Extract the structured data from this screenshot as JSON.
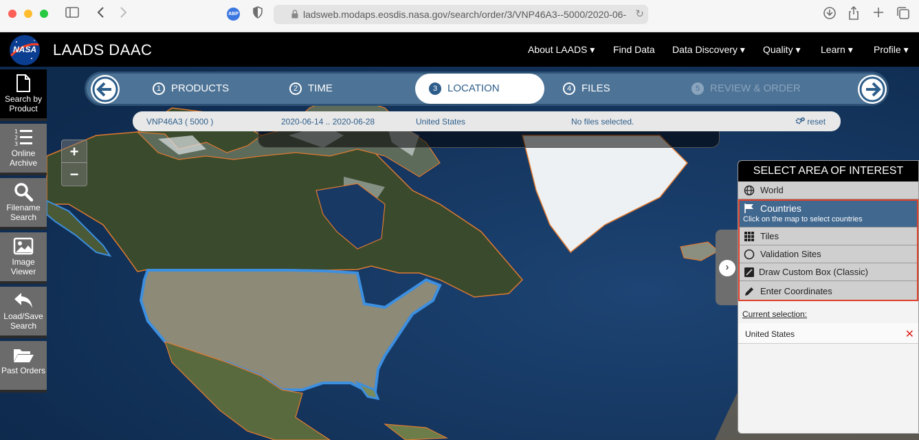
{
  "browser": {
    "url": "ladsweb.modaps.eosdis.nasa.gov/search/order/3/VNP46A3--5000/2020-06-",
    "extension_label": "ABP"
  },
  "site": {
    "logo_text": "NASA",
    "title": "LAADS DAAC",
    "nav": [
      "About LAADS ▾",
      "Find Data",
      "Data Discovery ▾",
      "Quality ▾",
      "Learn ▾",
      "Profile ▾"
    ]
  },
  "sidebar": [
    {
      "label_line1": "Search by",
      "label_line2": "Product"
    },
    {
      "label_line1": "Online",
      "label_line2": "Archive"
    },
    {
      "label_line1": "Filename",
      "label_line2": "Search"
    },
    {
      "label_line1": "Image",
      "label_line2": "Viewer"
    },
    {
      "label_line1": "Load/Save",
      "label_line2": "Search"
    },
    {
      "label_line1": "Past Orders",
      "label_line2": ""
    }
  ],
  "stepper": {
    "steps": [
      {
        "num": "1",
        "label": "PRODUCTS"
      },
      {
        "num": "2",
        "label": "TIME"
      },
      {
        "num": "3",
        "label": "LOCATION"
      },
      {
        "num": "4",
        "label": "FILES"
      },
      {
        "num": "5",
        "label": "REVIEW & ORDER"
      }
    ]
  },
  "summary": {
    "product": "VNP46A3 ( 5000 )",
    "dates": "2020-06-14 .. 2020-06-28",
    "location": "United States",
    "files": "No files selected.",
    "reset": "reset"
  },
  "zoom": {
    "in": "+",
    "out": "−"
  },
  "area_panel": {
    "title": "SELECT AREA OF INTEREST",
    "options": [
      {
        "label": "World",
        "icon": "globe-icon"
      },
      {
        "label": "Countries",
        "sub": "Click on the map to select countries",
        "icon": "flag-icon"
      },
      {
        "label": "Tiles",
        "icon": "grid-icon"
      },
      {
        "label": "Validation Sites",
        "icon": "circle-icon"
      },
      {
        "label": "Draw Custom Box (Classic)",
        "icon": "draw-box-icon"
      },
      {
        "label": "Enter Coordinates",
        "icon": "pencil-icon"
      }
    ],
    "current_label": "Current selection:",
    "current_item": "United States",
    "remove_glyph": "✕"
  },
  "colors": {
    "accent": "#2d5d8a",
    "panel_selected": "#41688f",
    "highlight": "#e0402a",
    "remove": "#e0241b"
  }
}
